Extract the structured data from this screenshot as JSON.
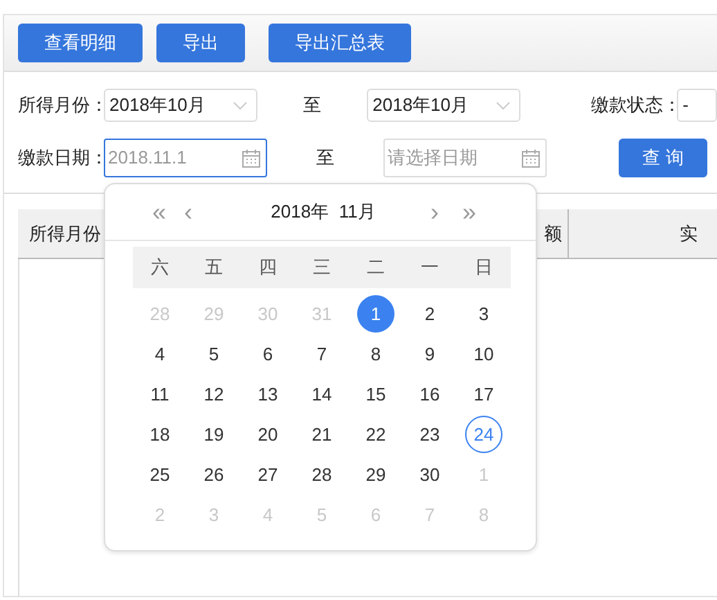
{
  "toolbar": {
    "buttons": [
      "查看明细",
      "导出",
      "导出汇总表"
    ]
  },
  "filters": {
    "income_month_label": "所得月份：",
    "income_month_from": "2018年10月",
    "to_1": "至",
    "income_month_to": "2018年10月",
    "pay_status_label": "缴款状态：",
    "pay_status_value": "-",
    "pay_date_label": "缴款日期：",
    "pay_date_from": {
      "value": "2018.11.1",
      "focused": true
    },
    "to_2": "至",
    "pay_date_to": {
      "placeholder": "请选择日期",
      "focused": false
    },
    "query_button": "查 询"
  },
  "table": {
    "columns": [
      "所得月份",
      "额",
      "实"
    ]
  },
  "date_picker": {
    "prev_year": "«",
    "prev_month": "‹",
    "title": "2018年  11月",
    "next_month": "›",
    "next_year": "»",
    "weekdays": [
      "六",
      "五",
      "四",
      "三",
      "二",
      "一",
      "日"
    ],
    "weeks": [
      [
        {
          "label": "28",
          "muted": true,
          "selected": false,
          "today": false
        },
        {
          "label": "29",
          "muted": true,
          "selected": false,
          "today": false
        },
        {
          "label": "30",
          "muted": true,
          "selected": false,
          "today": false
        },
        {
          "label": "31",
          "muted": true,
          "selected": false,
          "today": false
        },
        {
          "label": "1",
          "muted": false,
          "selected": true,
          "today": false
        },
        {
          "label": "2",
          "muted": false,
          "selected": false,
          "today": false
        },
        {
          "label": "3",
          "muted": false,
          "selected": false,
          "today": false
        }
      ],
      [
        {
          "label": "4",
          "muted": false,
          "selected": false,
          "today": false
        },
        {
          "label": "5",
          "muted": false,
          "selected": false,
          "today": false
        },
        {
          "label": "6",
          "muted": false,
          "selected": false,
          "today": false
        },
        {
          "label": "7",
          "muted": false,
          "selected": false,
          "today": false
        },
        {
          "label": "8",
          "muted": false,
          "selected": false,
          "today": false
        },
        {
          "label": "9",
          "muted": false,
          "selected": false,
          "today": false
        },
        {
          "label": "10",
          "muted": false,
          "selected": false,
          "today": false
        }
      ],
      [
        {
          "label": "11",
          "muted": false,
          "selected": false,
          "today": false
        },
        {
          "label": "12",
          "muted": false,
          "selected": false,
          "today": false
        },
        {
          "label": "13",
          "muted": false,
          "selected": false,
          "today": false
        },
        {
          "label": "14",
          "muted": false,
          "selected": false,
          "today": false
        },
        {
          "label": "15",
          "muted": false,
          "selected": false,
          "today": false
        },
        {
          "label": "16",
          "muted": false,
          "selected": false,
          "today": false
        },
        {
          "label": "17",
          "muted": false,
          "selected": false,
          "today": false
        }
      ],
      [
        {
          "label": "18",
          "muted": false,
          "selected": false,
          "today": false
        },
        {
          "label": "19",
          "muted": false,
          "selected": false,
          "today": false
        },
        {
          "label": "20",
          "muted": false,
          "selected": false,
          "today": false
        },
        {
          "label": "21",
          "muted": false,
          "selected": false,
          "today": false
        },
        {
          "label": "22",
          "muted": false,
          "selected": false,
          "today": false
        },
        {
          "label": "23",
          "muted": false,
          "selected": false,
          "today": false
        },
        {
          "label": "24",
          "muted": false,
          "selected": false,
          "today": true
        }
      ],
      [
        {
          "label": "25",
          "muted": false,
          "selected": false,
          "today": false
        },
        {
          "label": "26",
          "muted": false,
          "selected": false,
          "today": false
        },
        {
          "label": "27",
          "muted": false,
          "selected": false,
          "today": false
        },
        {
          "label": "28",
          "muted": false,
          "selected": false,
          "today": false
        },
        {
          "label": "29",
          "muted": false,
          "selected": false,
          "today": false
        },
        {
          "label": "30",
          "muted": false,
          "selected": false,
          "today": false
        },
        {
          "label": "1",
          "muted": true,
          "selected": false,
          "today": false
        }
      ],
      [
        {
          "label": "2",
          "muted": true,
          "selected": false,
          "today": false
        },
        {
          "label": "3",
          "muted": true,
          "selected": false,
          "today": false
        },
        {
          "label": "4",
          "muted": true,
          "selected": false,
          "today": false
        },
        {
          "label": "5",
          "muted": true,
          "selected": false,
          "today": false
        },
        {
          "label": "6",
          "muted": true,
          "selected": false,
          "today": false
        },
        {
          "label": "7",
          "muted": true,
          "selected": false,
          "today": false
        },
        {
          "label": "8",
          "muted": true,
          "selected": false,
          "today": false
        }
      ]
    ]
  }
}
